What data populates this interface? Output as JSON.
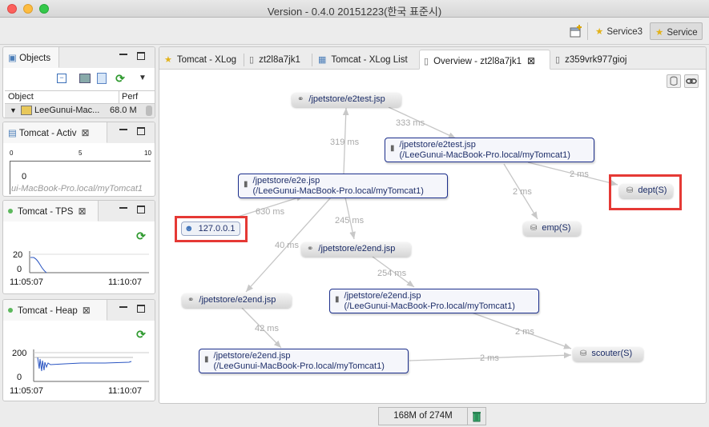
{
  "window": {
    "title": "Version - 0.4.0 20151223(한국 표준시)"
  },
  "toolbar": {
    "perspectives": [
      {
        "label": "Service3",
        "active": false
      },
      {
        "label": "Service",
        "active": true
      }
    ]
  },
  "objects_view": {
    "title": "Objects",
    "columns": [
      "Object",
      "Perf"
    ],
    "rows": [
      {
        "object": "LeeGunui-Mac...",
        "perf": "68.0 M"
      }
    ]
  },
  "active_view": {
    "title": "Tomcat - Activ",
    "ticks": [
      "0",
      "5",
      "10"
    ],
    "value": "0",
    "host": "ui-MacBook-Pro.local/myTomcat1"
  },
  "tps_view": {
    "title": "Tomcat - TPS",
    "y_ticks": [
      "20",
      "0"
    ],
    "x_ticks": [
      "11:05:07",
      "11:10:07"
    ]
  },
  "heap_view": {
    "title": "Tomcat - Heap",
    "y_ticks": [
      "200",
      "0"
    ],
    "x_ticks": [
      "11:05:07",
      "11:10:07"
    ]
  },
  "editor_tabs": [
    {
      "label": "Tomcat - XLog",
      "icon": "star"
    },
    {
      "label": "zt2l8a7jk1",
      "icon": "doc"
    },
    {
      "label": "Tomcat - XLog List",
      "icon": "grid"
    },
    {
      "label": "Overview - zt2l8a7jk1",
      "icon": "doc",
      "active": true
    },
    {
      "label": "z359vrk977gioj",
      "icon": "doc"
    }
  ],
  "diagram": {
    "nodes": {
      "e2test_link": "/jpetstore/e2test.jsp",
      "e2test_svc_1": "/jpetstore/e2test.jsp",
      "e2test_svc_2": "(/LeeGunui-MacBook-Pro.local/myTomcat1)",
      "dept": "dept(S)",
      "e2e_svc_1": "/jpetstore/e2e.jsp",
      "e2e_svc_2": "(/LeeGunui-MacBook-Pro.local/myTomcat1)",
      "client": "127.0.0.1",
      "emp": "emp(S)",
      "e2end_link_a": "/jpetstore/e2end.jsp",
      "e2end_svc_a_1": "/jpetstore/e2end.jsp",
      "e2end_svc_a_2": "(/LeeGunui-MacBook-Pro.local/myTomcat1)",
      "e2end_link_b": "/jpetstore/e2end.jsp",
      "scouter": "scouter(S)",
      "e2end_svc_b_1": "/jpetstore/e2end.jsp",
      "e2end_svc_b_2": "(/LeeGunui-MacBook-Pro.local/myTomcat1)"
    },
    "edges": {
      "e_333": "333 ms",
      "e_319": "319 ms",
      "e_2ms_dept": "2 ms",
      "e_2ms_emp": "2 ms",
      "e_630": "630 ms",
      "e_245": "245 ms",
      "e_40": "40 ms",
      "e_254": "254 ms",
      "e_2ms_scouter_a": "2 ms",
      "e_42": "42 ms",
      "e_2ms_scouter_b": "2 ms"
    }
  },
  "status": {
    "memory": "168M of 274M"
  }
}
